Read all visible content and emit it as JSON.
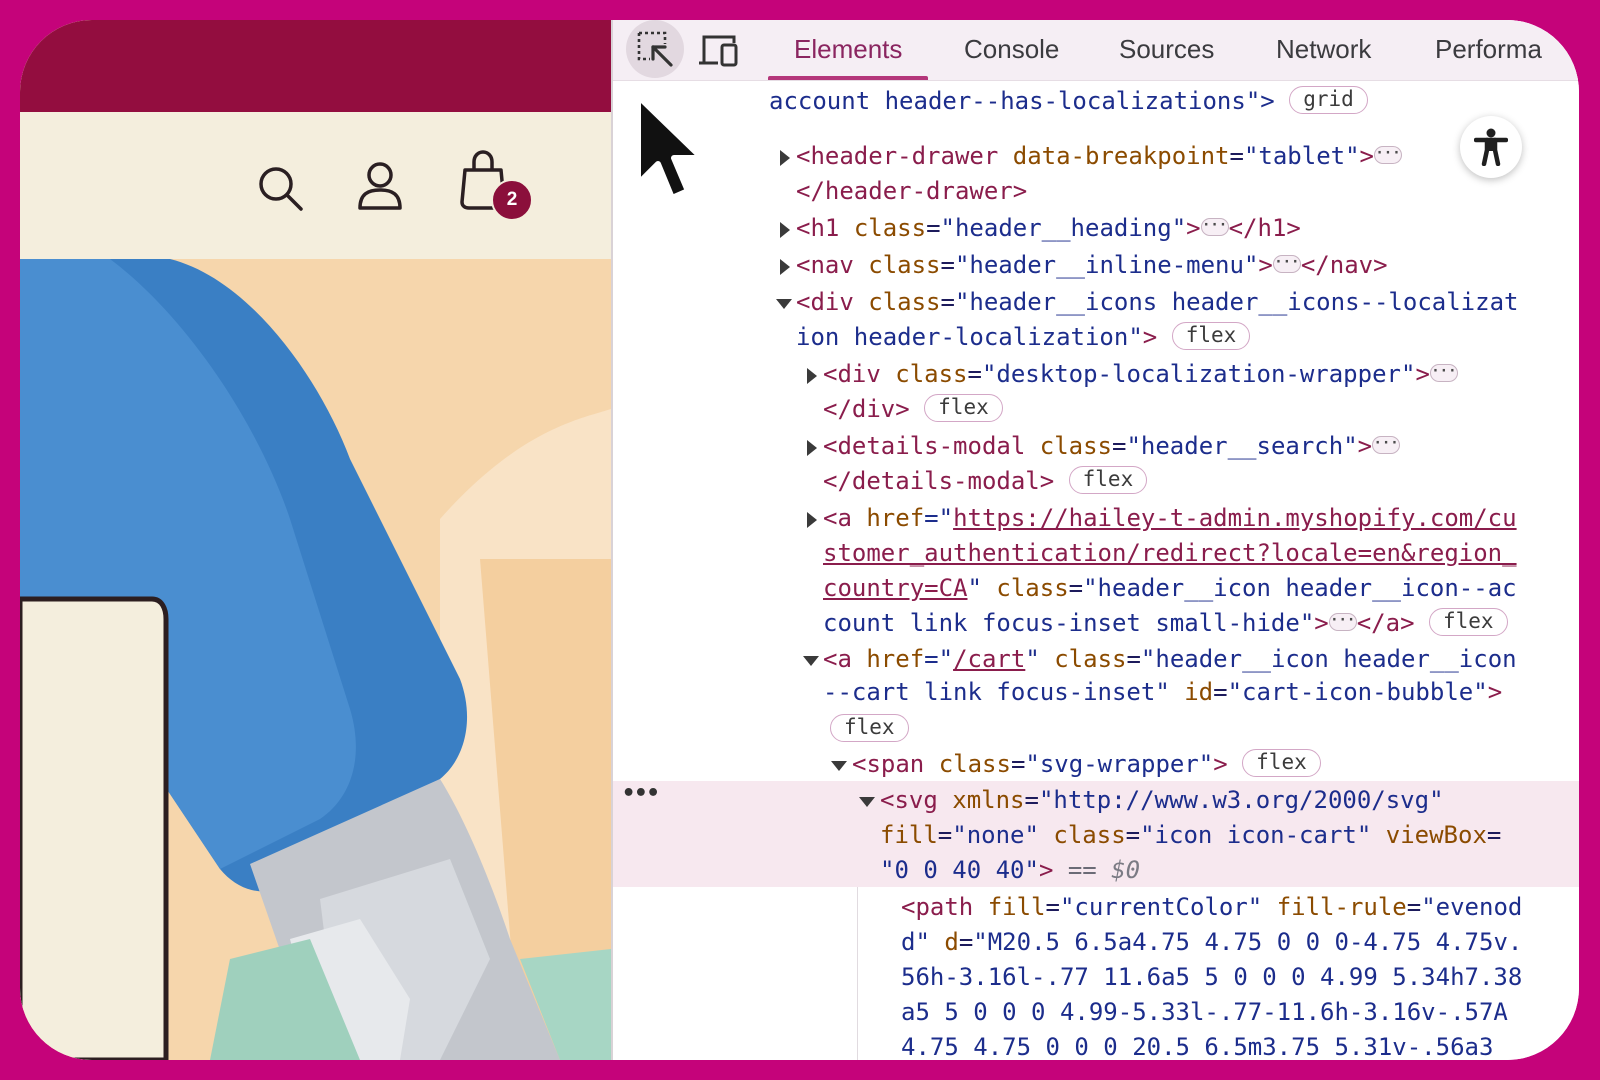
{
  "colors": {
    "frame": "#c5037a",
    "announcement_bar": "#930d3f",
    "header_bg": "#f4eedd",
    "hero_blue": "#3a7fc4",
    "cart_badge": "#8b0f3b",
    "devtools_accent": "#b4367a",
    "selected_row": "#f7e8ef"
  },
  "storefront": {
    "header_icons": [
      "search-icon",
      "account-icon",
      "cart-icon"
    ],
    "cart_count": "2"
  },
  "devtools": {
    "tool_icons": [
      "inspect-element-icon",
      "device-toggle-icon"
    ],
    "tabs": [
      "Elements",
      "Console",
      "Sources",
      "Network",
      "Performa"
    ],
    "active_tab": "Elements",
    "badges": {
      "grid": "grid",
      "flex": "flex"
    },
    "gutter_marker": "•••",
    "elements": {
      "l1": "account header--has-localizations\">",
      "l2": {
        "open": "<header-drawer",
        "attr": "data-breakpoint",
        "val": "\"tablet\"",
        "end": ">"
      },
      "l3": "</header-drawer>",
      "l4": {
        "open": "<h1",
        "attr": "class",
        "val": "\"header__heading\"",
        "end": ">",
        "close": "</h1>"
      },
      "l5": {
        "open": "<nav",
        "attr": "class",
        "val": "\"header__inline-menu\"",
        "end": ">",
        "close": "</nav>"
      },
      "l6": {
        "open": "<div",
        "attr": "class",
        "val": "\"header__icons header__icons--localizat"
      },
      "l7": {
        "val": "ion header-localization\"",
        "end": ">"
      },
      "l8": {
        "open": "<div",
        "attr": "class",
        "val": "\"desktop-localization-wrapper\"",
        "end": ">"
      },
      "l9": "</div>",
      "l10": {
        "open": "<details-modal",
        "attr": "class",
        "val": "\"header__search\"",
        "end": ">"
      },
      "l11": "</details-modal>",
      "l12": {
        "open": "<a",
        "attr": "href",
        "q": "=\"",
        "link": "https://hailey-t-admin.myshopify.com/cu"
      },
      "l13": {
        "link": "stomer_authentication/redirect?locale=en&region_"
      },
      "l14": {
        "link": "country=CA",
        "q": "\"",
        "attr": "class",
        "val": "\"header__icon header__icon--ac"
      },
      "l15": {
        "val": "count link focus-inset small-hide\"",
        "end": ">",
        "close": "</a>"
      },
      "l16": {
        "open": "<a",
        "attr": "href",
        "q": "=\"",
        "link": "/cart",
        "q2": "\"",
        "attr2": "class",
        "val": "\"header__icon header__icon"
      },
      "l17": {
        "val": "--cart link focus-inset\"",
        "attr": "id",
        "val2": "\"cart-icon-bubble\"",
        "end": ">"
      },
      "l19": {
        "open": "<span",
        "attr": "class",
        "val": "\"svg-wrapper\"",
        "end": ">"
      },
      "l20": {
        "open": "<svg",
        "attr": "xmlns",
        "val": "\"http://www.w3.org/2000/svg\""
      },
      "l21": {
        "attr": "fill",
        "val": "\"none\"",
        "attr2": "class",
        "val2": "\"icon icon-cart\"",
        "attr3": "viewBox"
      },
      "l22": {
        "val": "\"0 0 40 40\"",
        "end": ">",
        "eq": "==",
        "dollar": "$0"
      },
      "l23": {
        "open": "<path",
        "attr": "fill",
        "val": "\"currentColor\"",
        "attr2": "fill-rule",
        "val2": "\"evenod"
      },
      "l24": {
        "val": "d\"",
        "attr": "d",
        "val2": "\"M20.5 6.5a4.75 4.75 0 0 0-4.75 4.75v."
      },
      "l25": "56h-3.16l-.77 11.6a5 5 0 0 0 4.99 5.34h7.38",
      "l26": "a5 5 0 0 0 4.99-5.33l-.77-11.6h-3.16v-.57A",
      "l27": "4.75 4.75 0 0 0 20.5 6.5m3.75 5.31v-.56a3"
    },
    "floating_icons": [
      "accessibility-icon",
      "mouse-cursor-icon"
    ]
  }
}
